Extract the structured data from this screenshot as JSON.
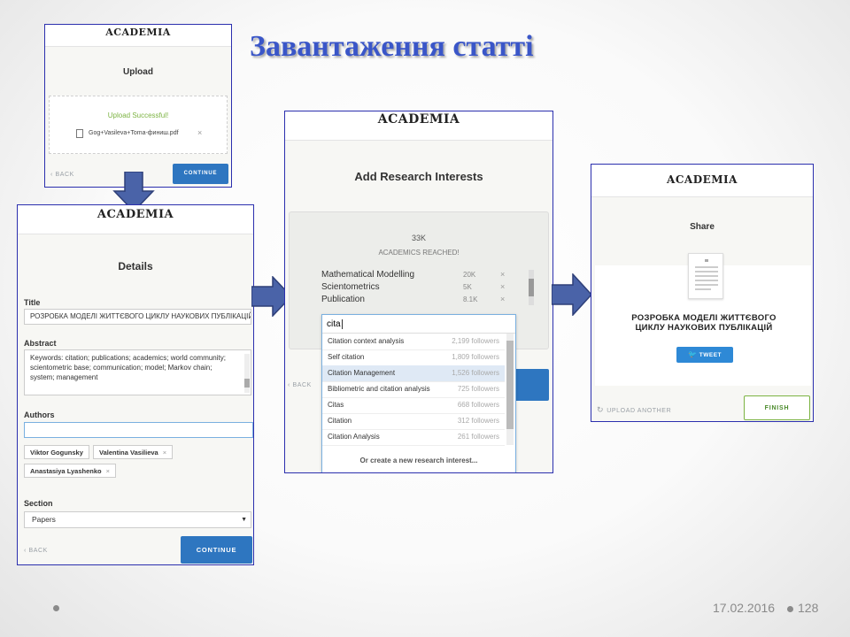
{
  "slide": {
    "title": "Завантаження статті",
    "date": "17.02.2016",
    "page_number": "128"
  },
  "upload_panel": {
    "logo": "ACADEMIA",
    "heading": "Upload",
    "success_text": "Upload Successful!",
    "file_name": "Gog+Vasileva+Toma-финиш.pdf",
    "remove_symbol": "×",
    "back_label": "BACK",
    "continue_label": "CONTINUE"
  },
  "details_panel": {
    "logo": "ACADEMIA",
    "heading": "Details",
    "title_label": "Title",
    "title_value": "РОЗРОБКА МОДЕЛІ ЖИТТЄВОГО ЦИКЛУ НАУКОВИХ ПУБЛІКАЦІЙ",
    "abstract_label": "Abstract",
    "abstract_value": "Keywords: citation; publications; academics; world community; scientometric base; communication; model; Markov chain; system; management",
    "authors_label": "Authors",
    "authors": [
      {
        "name": "Viktor Gogunsky"
      },
      {
        "name": "Valentina Vasilieva"
      },
      {
        "name": "Anastasiya Lyashenko"
      }
    ],
    "remove_symbol": "×",
    "section_label": "Section",
    "section_value": "Papers",
    "back_label": "BACK",
    "continue_label": "CONTINUE"
  },
  "interests_panel": {
    "logo": "ACADEMIA",
    "heading": "Add Research Interests",
    "reach_count": "33K",
    "reach_label": "ACADEMICS REACHED!",
    "interests": [
      {
        "name": "Mathematical Modelling",
        "count": "20K"
      },
      {
        "name": "Scientometrics",
        "count": "5K"
      },
      {
        "name": "Publication",
        "count": "8.1K"
      }
    ],
    "remove_symbol": "×",
    "search_value": "cita",
    "suggestions": [
      {
        "name": "Citation context analysis",
        "followers": "2,199 followers"
      },
      {
        "name": "Self citation",
        "followers": "1,809 followers"
      },
      {
        "name": "Citation Management",
        "followers": "1,526 followers"
      },
      {
        "name": "Bibliometric and citation analysis",
        "followers": "725 followers"
      },
      {
        "name": "Citas",
        "followers": "668 followers"
      },
      {
        "name": "Citation",
        "followers": "312 followers"
      },
      {
        "name": "Citation Analysis",
        "followers": "261 followers"
      }
    ],
    "selected_index": 2,
    "create_new_label": "Or create a new research interest...",
    "back_label": "BACK"
  },
  "share_panel": {
    "logo": "ACADEMIA",
    "heading": "Share",
    "paper_title": "РОЗРОБКА МОДЕЛІ ЖИТТЄВОГО ЦИКЛУ НАУКОВИХ ПУБЛІКАЦІЙ",
    "tweet_label": "TWEET",
    "upload_another_label": "UPLOAD ANOTHER",
    "finish_label": "FINISH"
  },
  "colors": {
    "title_blue": "#3a56c8",
    "button_blue": "#2e76c0",
    "arrow_blue": "#4a63a8",
    "success_green": "#7cb342",
    "twitter_blue": "#1da1f2",
    "finish_green": "#4a8a2a"
  }
}
